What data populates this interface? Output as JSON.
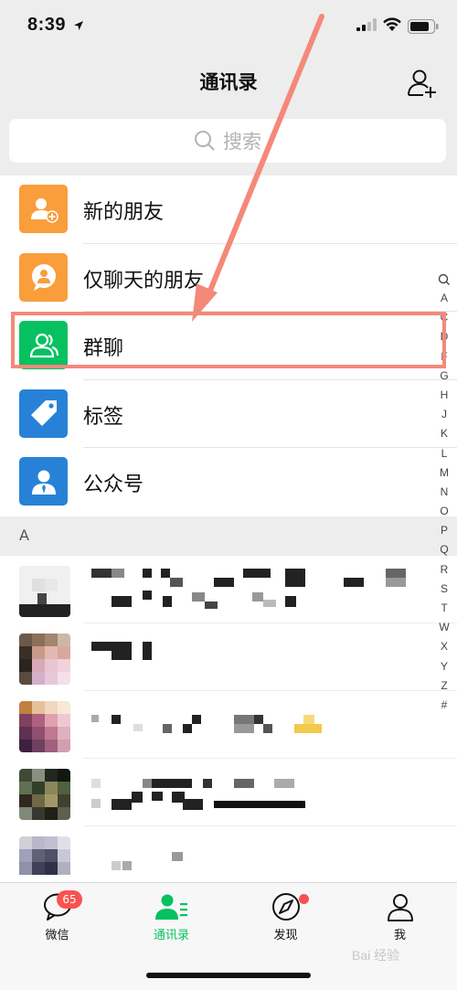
{
  "status_bar": {
    "time": "8:39"
  },
  "nav": {
    "title": "通讯录"
  },
  "search": {
    "placeholder": "搜索"
  },
  "function_items": [
    {
      "label": "新的朋友",
      "icon": "new-friend-icon",
      "color": "#fa9d3b"
    },
    {
      "label": "仅聊天的朋友",
      "icon": "chat-only-friend-icon",
      "color": "#fa9d3b"
    },
    {
      "label": "群聊",
      "icon": "group-chat-icon",
      "color": "#07c160"
    },
    {
      "label": "标签",
      "icon": "tag-icon",
      "color": "#2782d7"
    },
    {
      "label": "公众号",
      "icon": "official-account-icon",
      "color": "#2782d7"
    }
  ],
  "section": {
    "letter": "A"
  },
  "index_letters": [
    "A",
    "C",
    "D",
    "F",
    "G",
    "H",
    "J",
    "K",
    "L",
    "M",
    "N",
    "O",
    "P",
    "Q",
    "R",
    "S",
    "T",
    "W",
    "X",
    "Y",
    "Z",
    "#"
  ],
  "tabs": [
    {
      "label": "微信",
      "icon": "chat-bubble-icon",
      "badge": "65"
    },
    {
      "label": "通讯录",
      "icon": "contacts-icon",
      "active": true
    },
    {
      "label": "发现",
      "icon": "compass-icon"
    },
    {
      "label": "我",
      "icon": "person-icon"
    }
  ],
  "colors": {
    "accent_green": "#07c160",
    "orange": "#fa9d3b",
    "blue": "#2782d7",
    "badge_red": "#fa5151",
    "annotation": "#f4897a"
  },
  "watermark": "Bai 经验"
}
